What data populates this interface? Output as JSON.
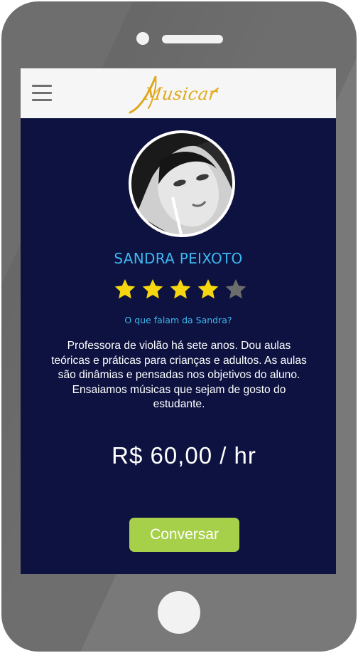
{
  "header": {
    "menu_icon": "hamburger-menu-icon",
    "logo_text": "Musicar"
  },
  "profile": {
    "name": "SANDRA PEIXOTO",
    "rating": 4,
    "rating_max": 5,
    "reviews_link": "O que falam da Sandra?",
    "bio": "Professora de violão há sete anos. Dou aulas teóricas e práticas para crianças e adultos. As aulas são dinâmias e pensadas nos objetivos do aluno. Ensaiamos músicas que sejam de gosto do estudante.",
    "price": "R$ 60,00 / hr",
    "chat_button": "Conversar"
  },
  "colors": {
    "screen_bg": "#0d1240",
    "accent_blue": "#3db8f0",
    "star_filled": "#f5d60f",
    "star_empty": "#6c6c6c",
    "button_green": "#a6cf4a",
    "logo_gold": "#e0a81c"
  }
}
